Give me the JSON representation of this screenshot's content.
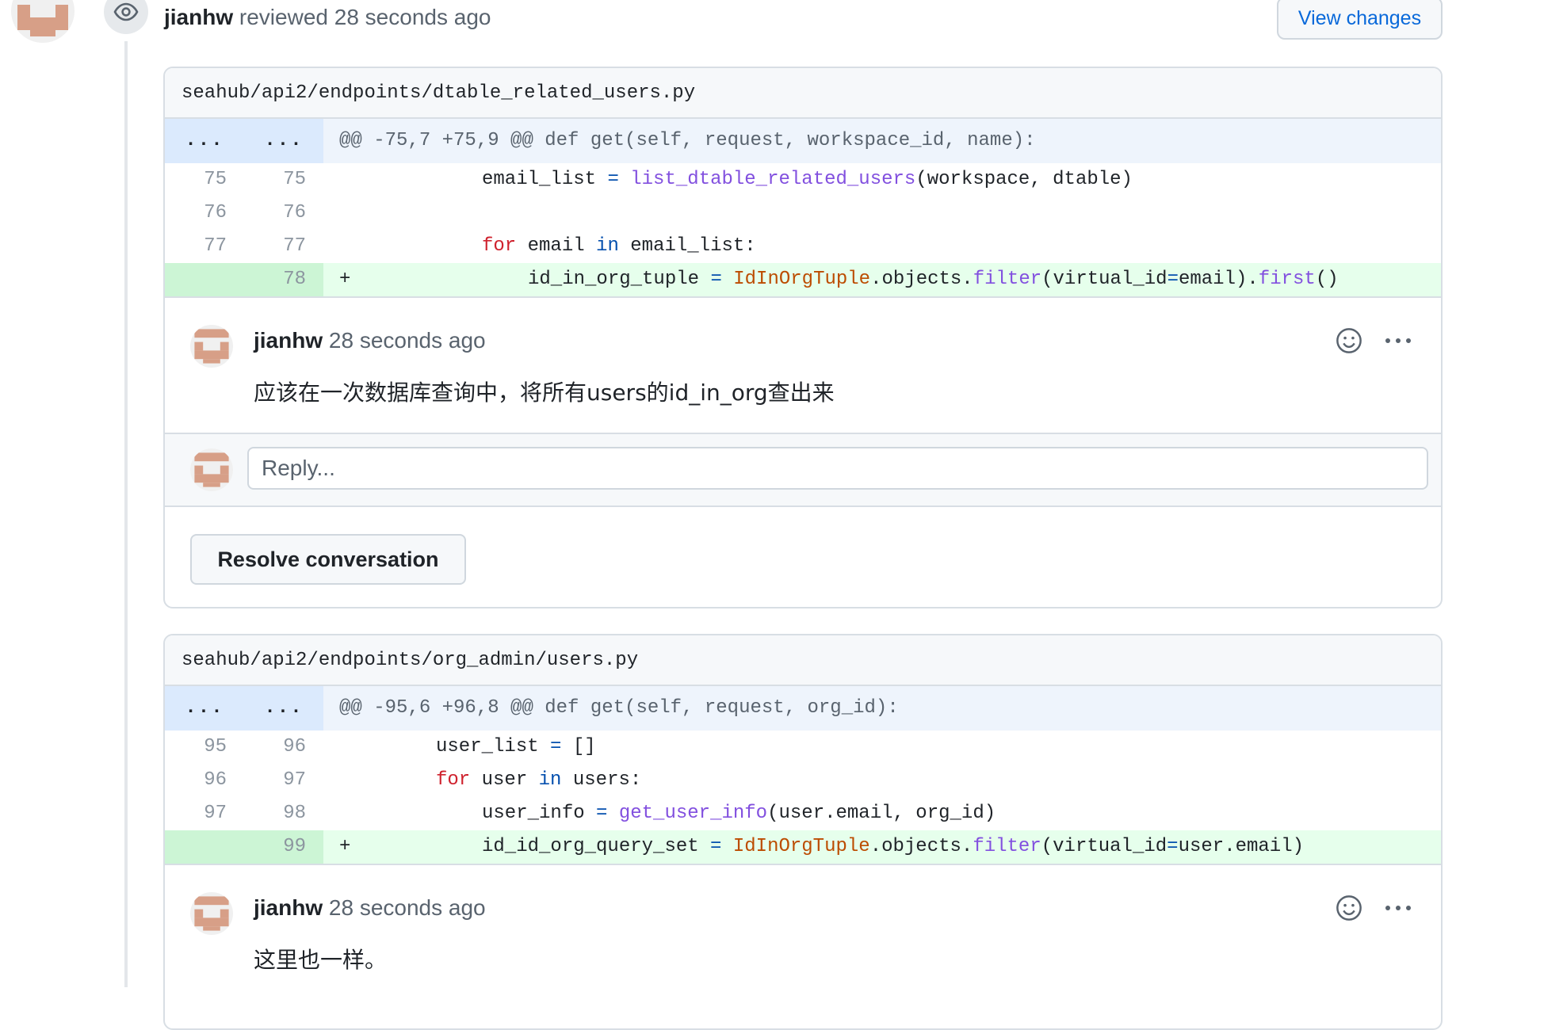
{
  "review": {
    "user": "jianhw",
    "action": "reviewed",
    "time": "28 seconds ago",
    "view_changes_label": "View changes"
  },
  "threads": [
    {
      "file": "seahub/api2/endpoints/dtable_related_users.py",
      "hunk_left": "...",
      "hunk_right": "...",
      "hunk": "@@ -75,7 +75,9 @@ def get(self, request, workspace_id, name):",
      "lines": [
        {
          "old": "75",
          "new": "75"
        },
        {
          "old": "76",
          "new": "76"
        },
        {
          "old": "77",
          "new": "77"
        },
        {
          "old": "",
          "new": "78",
          "marker": "+"
        }
      ],
      "comment": {
        "user": "jianhw",
        "time": "28 seconds ago",
        "body": "应该在一次数据库查询中，将所有users的id_in_org查出来"
      },
      "reply_placeholder": "Reply...",
      "resolve_label": "Resolve conversation"
    },
    {
      "file": "seahub/api2/endpoints/org_admin/users.py",
      "hunk_left": "...",
      "hunk_right": "...",
      "hunk": "@@ -95,6 +96,8 @@ def get(self, request, org_id):",
      "lines": [
        {
          "old": "95",
          "new": "96"
        },
        {
          "old": "96",
          "new": "97"
        },
        {
          "old": "97",
          "new": "98"
        },
        {
          "old": "",
          "new": "99",
          "marker": "+"
        }
      ],
      "comment": {
        "user": "jianhw",
        "time": "28 seconds ago",
        "body": "这里也一样。"
      }
    }
  ],
  "code": {
    "t0l0": {
      "a": "email_list ",
      "b": "=",
      "c": " ",
      "d": "list_dtable_related_users",
      "e": "(workspace, dtable)"
    },
    "t0l2": {
      "a": "for",
      "b": " email ",
      "c": "in",
      "d": " email_list:"
    },
    "t0l3": {
      "a": "id_in_org_tuple ",
      "b": "=",
      "c": " ",
      "d": "IdInOrgTuple",
      "e": ".objects.",
      "f": "filter",
      "g": "(virtual_id",
      "h": "=",
      "i": "email).",
      "j": "first",
      "k": "()"
    },
    "t1l0": {
      "a": "user_list ",
      "b": "=",
      "c": " []"
    },
    "t1l1": {
      "a": "for",
      "b": " user ",
      "c": "in",
      "d": " users:"
    },
    "t1l2": {
      "a": "user_info ",
      "b": "=",
      "c": " ",
      "d": "get_user_info",
      "e": "(user.email, org_id)"
    },
    "t1l3": {
      "a": "id_id_org_query_set ",
      "b": "=",
      "c": " ",
      "d": "IdInOrgTuple",
      "e": ".objects.",
      "f": "filter",
      "g": "(virtual_id",
      "h": "=",
      "i": "user.email)"
    }
  },
  "icons": [
    "eye-icon",
    "smiley-icon",
    "kebab-horizontal-icon"
  ],
  "colors": {
    "accent": "#0969da",
    "addition_bg": "#e6ffec",
    "addition_num_bg": "#ccf5d5",
    "hunk_bg": "#eef4fc",
    "keyword": "#cf222e",
    "class": "#bc4c00",
    "function": "#8250df"
  }
}
